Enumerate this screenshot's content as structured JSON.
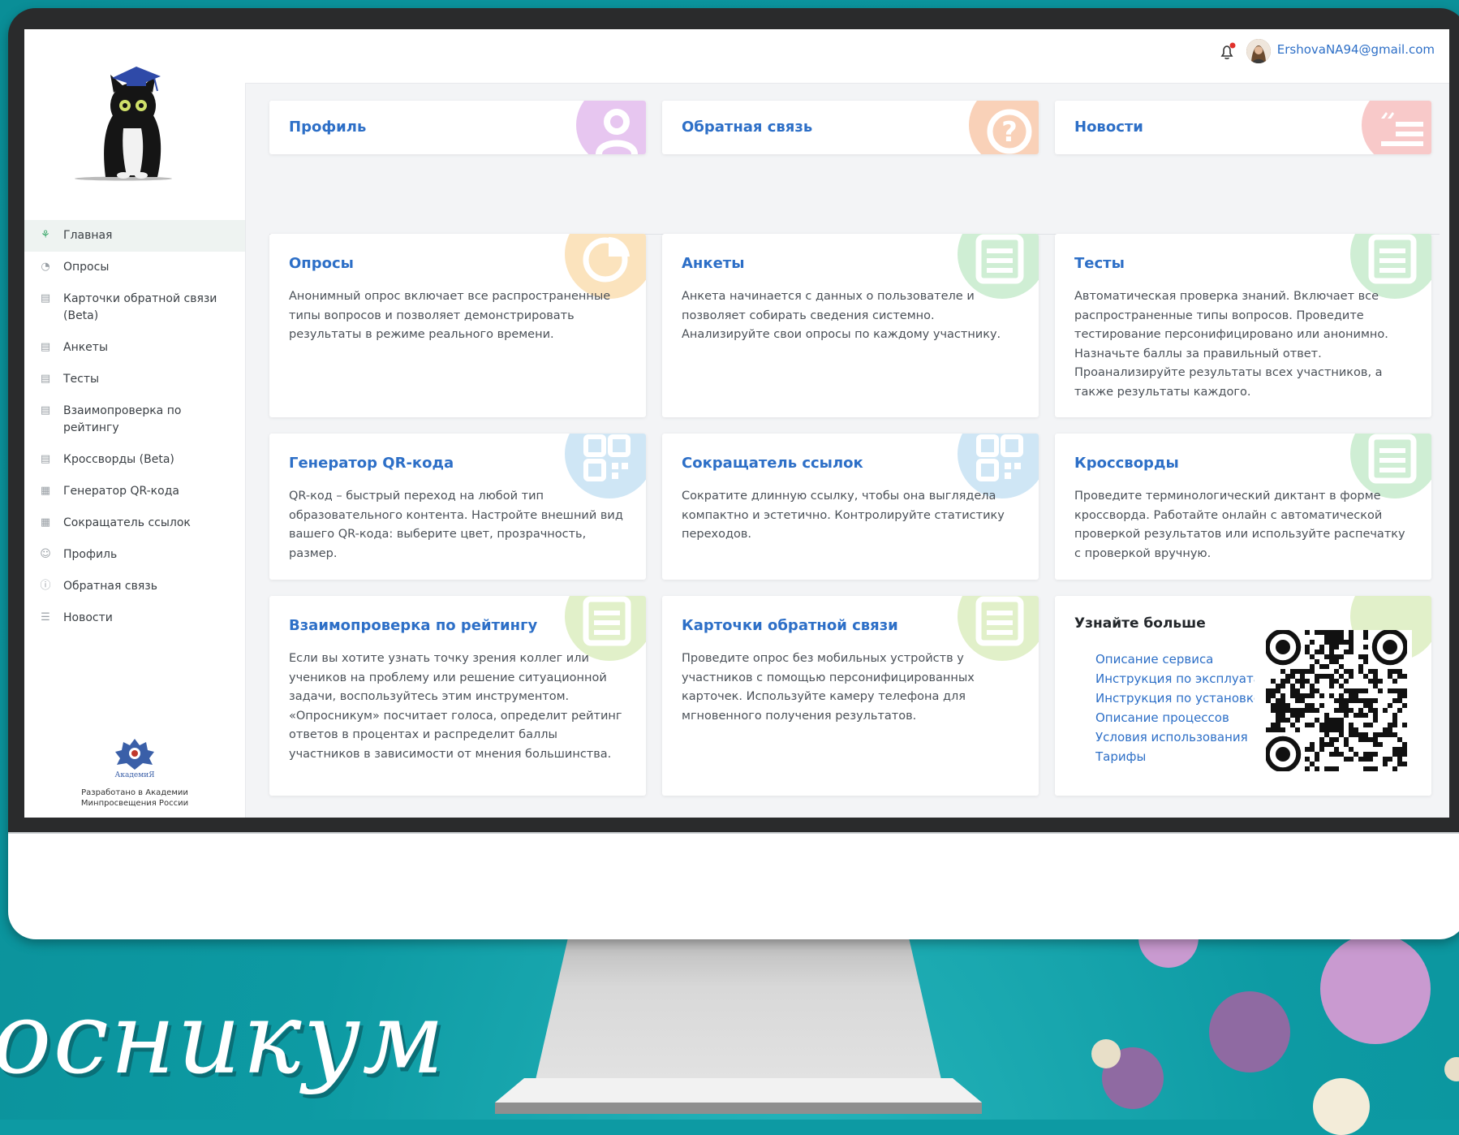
{
  "header": {
    "user_email": "ErshovaNA94@gmail.com"
  },
  "sidebar": {
    "items": [
      {
        "label": "Главная",
        "icon": "home-network-icon",
        "active": true
      },
      {
        "label": "Опросы",
        "icon": "pie-chart-icon"
      },
      {
        "label": "Карточки обратной связи (Beta)",
        "icon": "list-icon"
      },
      {
        "label": "Анкеты",
        "icon": "list-icon"
      },
      {
        "label": "Тесты",
        "icon": "list-icon"
      },
      {
        "label": "Взаимопроверка по рейтингу",
        "icon": "list-icon"
      },
      {
        "label": "Кроссворды (Beta)",
        "icon": "list-icon"
      },
      {
        "label": "Генератор QR-кода",
        "icon": "qr-icon"
      },
      {
        "label": "Сокращатель ссылок",
        "icon": "qr-icon"
      },
      {
        "label": "Профиль",
        "icon": "user-icon"
      },
      {
        "label": "Обратная связь",
        "icon": "question-icon"
      },
      {
        "label": "Новости",
        "icon": "news-icon"
      }
    ],
    "credit_text": "Разработано в Академии Минпросвещения России"
  },
  "quick_links": [
    {
      "title": "Профиль",
      "icon": "user-icon",
      "color": "#e7c6f0"
    },
    {
      "title": "Обратная связь",
      "icon": "question-icon",
      "color": "#f9d1b8"
    },
    {
      "title": "Новости",
      "icon": "news-icon",
      "color": "#f8c9c9"
    }
  ],
  "cards": [
    {
      "title": "Опросы",
      "text": "Анонимный опрос включает все распространенные типы вопросов и позволяет демонстрировать результаты в режиме реального времени.",
      "icon": "pie-chart-icon",
      "color": "#fbe3bd"
    },
    {
      "title": "Анкеты",
      "text": "Анкета начинается с данных о пользователе и позволяет собирать сведения системно. Анализируйте свои опросы по каждому участнику.",
      "icon": "list-icon",
      "color": "#cfeed4"
    },
    {
      "title": "Тесты",
      "text": "Автоматическая проверка знаний. Включает все распространенные типы вопросов. Проведите тестирование персонифицировано или анонимно. Назначьте баллы за правильный ответ. Проанализируйте результаты всех участников, а также результаты каждого.",
      "icon": "list-icon",
      "color": "#cfeed4"
    },
    {
      "title": "Генератор QR-кода",
      "text": "QR-код – быстрый переход на любой тип образовательного контента. Настройте внешний вид вашего QR-кода: выберите цвет, прозрачность, размер.",
      "icon": "qr-icon",
      "color": "#cfe6f5"
    },
    {
      "title": "Сокращатель ссылок",
      "text": "Сократите длинную ссылку, чтобы она выглядела компактно и эстетично. Контролируйте статистику переходов.",
      "icon": "qr-icon",
      "color": "#cfe6f5"
    },
    {
      "title": "Кроссворды",
      "text": "Проведите терминологический диктант в форме кроссворда. Работайте онлайн с автоматической проверкой результатов или используйте распечатку с проверкой вручную.",
      "icon": "list-icon",
      "color": "#cfeed4"
    },
    {
      "title": "Взаимопроверка по рейтингу",
      "text": "Если вы хотите узнать точку зрения коллег или учеников на проблему или решение ситуационной задачи, воспользуйтесь этим инструментом. «Опросникум» посчитает голоса, определит рейтинг ответов в процентах и распределит баллы участников в зависимости от мнения большинства.",
      "icon": "list-icon",
      "color": "#e1f0c9"
    },
    {
      "title": "Карточки обратной связи",
      "text": "Проведите опрос без мобильных устройств у участников с помощью персонифицированных карточек. Используйте камеру телефона для мгновенного получения результатов.",
      "icon": "list-icon",
      "color": "#e1f0c9"
    }
  ],
  "learn_more": {
    "title": "Узнайте больше",
    "links": [
      "Описание сервиса",
      "Инструкция по эксплуатац",
      "Инструкция по установке",
      "Описание процессов",
      "Условия использования",
      "Тарифы"
    ]
  },
  "slide_wordmark": "осникум",
  "theme": {
    "accent": "#2d6fc7",
    "active_green": "#3aa86a",
    "background": "#0d9aa3"
  }
}
